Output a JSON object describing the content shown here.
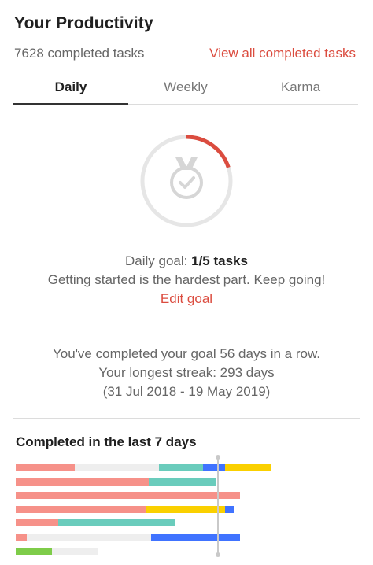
{
  "header": {
    "title": "Your Productivity",
    "completed_tasks": "7628 completed tasks",
    "view_all_label": "View all completed tasks"
  },
  "tabs": [
    {
      "label": "Daily",
      "active": true
    },
    {
      "label": "Weekly",
      "active": false
    },
    {
      "label": "Karma",
      "active": false
    }
  ],
  "daily_goal": {
    "label_prefix": "Daily goal: ",
    "value": "1/5 tasks",
    "progress_fraction": 0.2,
    "message": "Getting started is the hardest part. Keep going!",
    "edit_label": "Edit goal",
    "icon": "medal-check-icon"
  },
  "streak": {
    "current": "You've completed your goal 56 days in a row.",
    "longest": "Your longest streak: 293 days",
    "range": "(31 Jul 2018 - 19 May 2019)"
  },
  "last7": {
    "title": "Completed in the last 7 days"
  },
  "colors": {
    "accent": "#db4c3f",
    "salmon": "#f69189",
    "teal": "#6accbc",
    "yellow": "#fad000",
    "blue": "#4073ff",
    "green": "#7ecc49",
    "empty": "#eeeeee",
    "ring_track": "#e6e6e6"
  }
}
